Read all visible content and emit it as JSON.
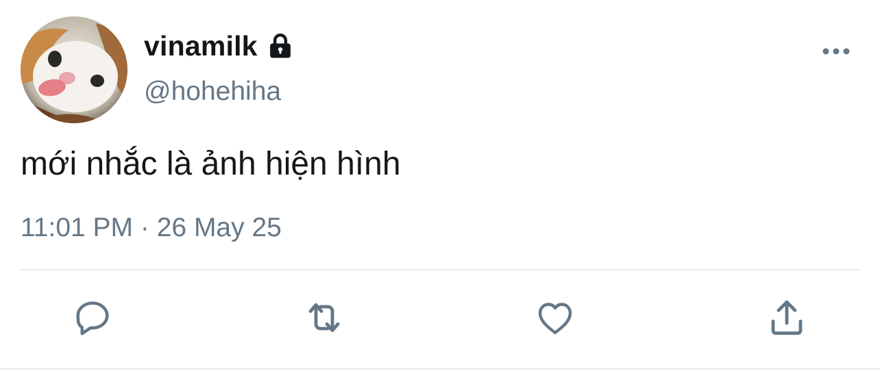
{
  "user": {
    "display_name": "vinamilk",
    "handle": "@hohehiha",
    "avatar": "cat-avatar-photo",
    "protected": true,
    "protected_icon": "lock-icon"
  },
  "tweet": {
    "text": "mới nhắc là ảnh hiện hình",
    "time": "11:01 PM",
    "separator": "·",
    "date": "26 May 25"
  },
  "actions": [
    {
      "name": "reply",
      "icon": "reply-icon"
    },
    {
      "name": "retweet",
      "icon": "retweet-icon"
    },
    {
      "name": "like",
      "icon": "heart-icon"
    },
    {
      "name": "share",
      "icon": "share-icon"
    }
  ],
  "menu": {
    "icon": "more-options-icon"
  },
  "colors": {
    "text_primary": "#14171a",
    "text_secondary": "#657786",
    "icon": "#657786",
    "divider": "#e6ecf0"
  }
}
